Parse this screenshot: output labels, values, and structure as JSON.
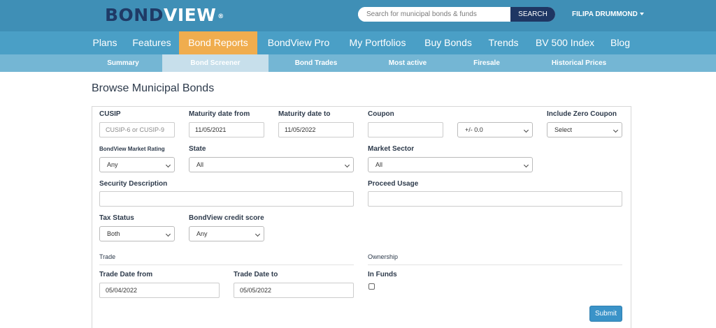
{
  "header": {
    "logo": {
      "part1": "BOND",
      "part2": "VIEW",
      "reg": "®"
    },
    "search": {
      "placeholder": "Search for municipal bonds & funds",
      "button_label": "SEARCH"
    },
    "user": {
      "name": "FILIPA DRUMMOND"
    }
  },
  "main_nav": {
    "items": [
      "Plans",
      "Features",
      "Bond Reports",
      "BondView Pro",
      "My Portfolios",
      "Buy Bonds",
      "Trends",
      "BV 500 Index",
      "Blog"
    ],
    "active": "Bond Reports"
  },
  "sub_nav": {
    "items": [
      "Summary",
      "Bond Screener",
      "Bond Trades",
      "Most active",
      "Firesale",
      "Historical Prices"
    ],
    "active": "Bond Screener"
  },
  "page_title": "Browse Municipal Bonds",
  "form": {
    "cusip": {
      "label": "CUSIP",
      "placeholder": "CUSIP-6 or CUSIP-9",
      "value": ""
    },
    "maturity_from": {
      "label": "Maturity date from",
      "value": "11/05/2021"
    },
    "maturity_to": {
      "label": "Maturity date to",
      "value": "11/05/2022"
    },
    "coupon": {
      "label": "Coupon",
      "value": "",
      "tolerance": "+/- 0.0"
    },
    "zero_coupon": {
      "label": "Include Zero Coupon",
      "value": "Select"
    },
    "market_rating": {
      "label": "BondView Market Rating",
      "value": "Any"
    },
    "state": {
      "label": "State",
      "value": "All"
    },
    "market_sector": {
      "label": "Market Sector",
      "value": "All"
    },
    "security_description": {
      "label": "Security Description",
      "value": ""
    },
    "proceed_usage": {
      "label": "Proceed Usage",
      "value": ""
    },
    "tax_status": {
      "label": "Tax Status",
      "value": "Both"
    },
    "credit_score": {
      "label": "BondView credit score",
      "value": "Any"
    },
    "trade_section": "Trade",
    "ownership_section": "Ownership",
    "trade_date_from": {
      "label": "Trade Date from",
      "value": "05/04/2022"
    },
    "trade_date_to": {
      "label": "Trade Date to",
      "value": "05/05/2022"
    },
    "in_funds": {
      "label": "In Funds",
      "checked": false
    },
    "submit_label": "Submit"
  }
}
